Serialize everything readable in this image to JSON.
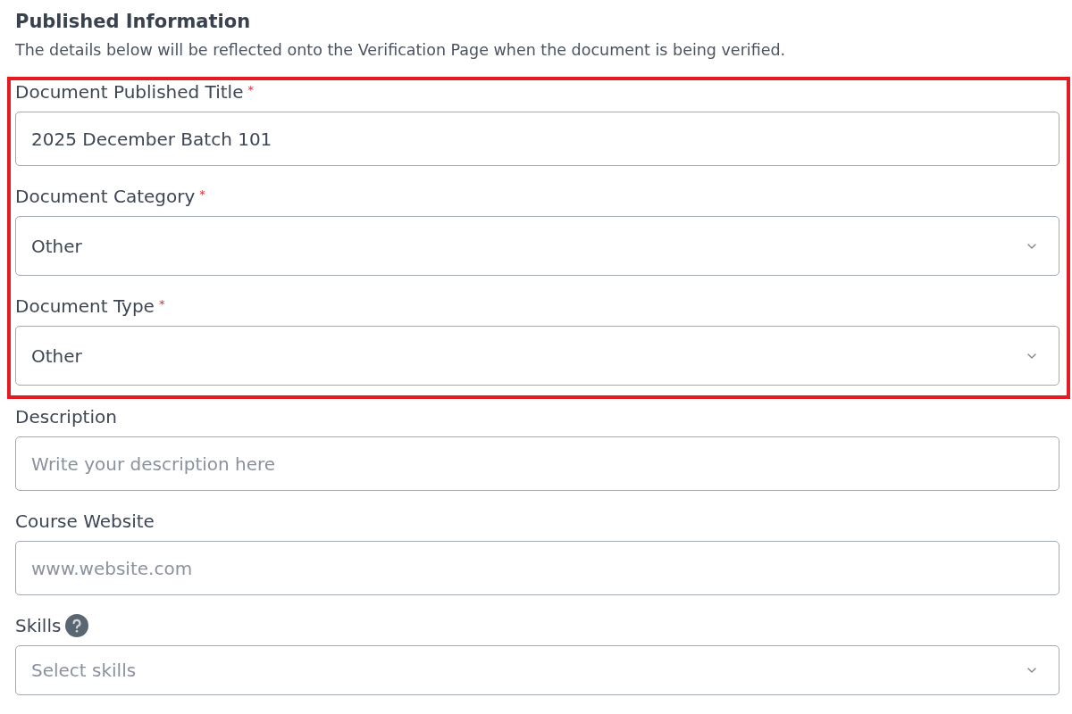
{
  "section": {
    "title": "Published Information",
    "description": "The details below will be reflected onto the Verification Page when the document is being verified."
  },
  "fields": [
    {
      "label": "Document Published Title",
      "required_mark": "*",
      "help": false,
      "kind": "text",
      "value": "2025 December Batch 101",
      "highlighted": true
    },
    {
      "label": "Document Category",
      "required_mark": "*",
      "help": false,
      "kind": "select",
      "value": "Other",
      "highlighted": true
    },
    {
      "label": "Document Type",
      "required_mark": "*",
      "help": false,
      "kind": "select",
      "value": "Other",
      "highlighted": true
    },
    {
      "label": "Description",
      "help": false,
      "kind": "text",
      "placeholder": "Write your description here",
      "highlighted": false
    },
    {
      "label": "Course Website",
      "help": false,
      "kind": "text",
      "placeholder": "www.website.com",
      "highlighted": false
    },
    {
      "label": "Skills",
      "help": true,
      "kind": "multi_select",
      "placeholder": "Select skills",
      "highlighted": false
    }
  ]
}
